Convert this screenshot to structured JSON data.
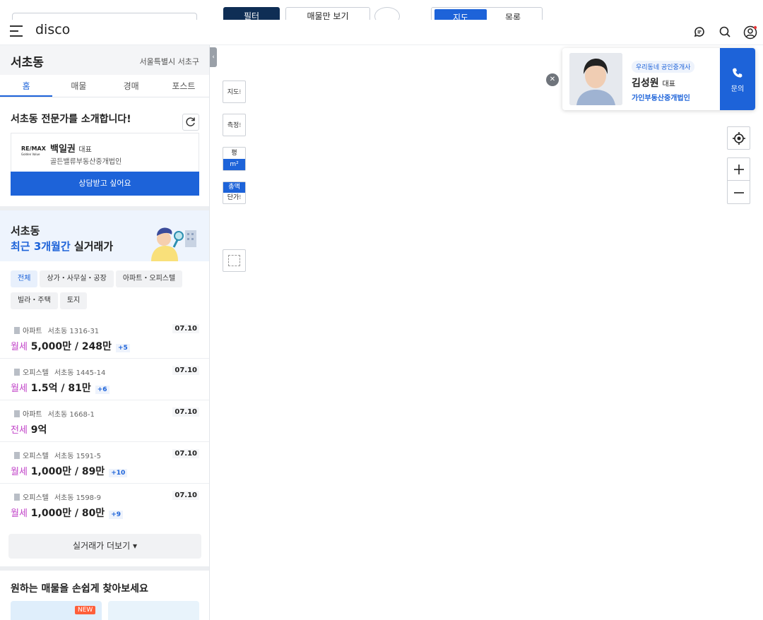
{
  "top_strip": {
    "filter_label": "필터",
    "only_listings_label": "매물만 보기",
    "map_label": "지도",
    "list_label": "목록"
  },
  "header": {
    "logo": "disco"
  },
  "sidebar": {
    "location": {
      "dong": "서초동",
      "city": "서울특별시 서초구"
    },
    "tabs": [
      "홈",
      "매물",
      "경매",
      "포스트"
    ],
    "expert": {
      "title": "서초동 전문가를 소개합니다!",
      "logo_text": "RE/MAX",
      "logo_sub": "Golden Value",
      "name": "백일권",
      "role": "대표",
      "office": "골든밸류부동산중개법인",
      "button": "상담받고 싶어요"
    },
    "recent": {
      "dong": "서초동",
      "highlight": "최근 3개월간",
      "suffix": "실거래가"
    },
    "chips": [
      "전체",
      "상가・사무실・공장",
      "아파트・오피스텔",
      "빌라・주택",
      "토지"
    ],
    "transactions": [
      {
        "type": "아파트",
        "addr": "서초동 1316-31",
        "date": "07.10",
        "kind": "월세",
        "price": "5,000만 / 248만",
        "plus": "+5"
      },
      {
        "type": "오피스텔",
        "addr": "서초동 1445-14",
        "date": "07.10",
        "kind": "월세",
        "price": "1.5억 / 81만",
        "plus": "+6"
      },
      {
        "type": "아파트",
        "addr": "서초동 1668-1",
        "date": "07.10",
        "kind": "전세",
        "price": "9억",
        "plus": ""
      },
      {
        "type": "오피스텔",
        "addr": "서초동 1591-5",
        "date": "07.10",
        "kind": "월세",
        "price": "1,000만 / 89만",
        "plus": "+10"
      },
      {
        "type": "오피스텔",
        "addr": "서초동 1598-9",
        "date": "07.10",
        "kind": "월세",
        "price": "1,000만 / 80만",
        "plus": "+9"
      }
    ],
    "more_button": "실거래가 더보기 ▾",
    "find_title": "원하는 매물을 손쉽게 찾아보세요",
    "new_badge": "NEW"
  },
  "map": {
    "map_type_btn": "지도⁝",
    "measure_btn": "측정⁝",
    "unit_pyeong": "평",
    "unit_m2": "m²",
    "price_total": "총액",
    "price_unit": "단가⁝"
  },
  "broker": {
    "tag": "우리동네 공인중개사",
    "name": "김성원",
    "role": "대표",
    "office": "가인부동산중개법인",
    "call_label": "문의"
  },
  "colors": {
    "accent": "#1d63d9",
    "kind": "#c143c8"
  }
}
